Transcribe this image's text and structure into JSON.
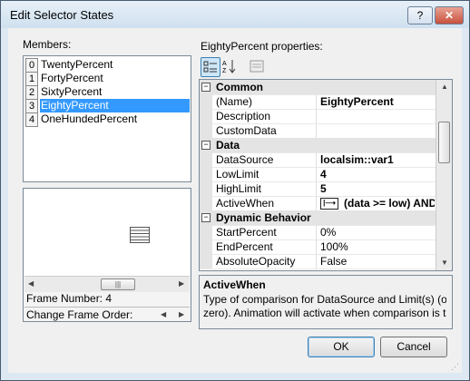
{
  "window": {
    "title": "Edit Selector States",
    "help_label": "?",
    "close_label": "✕"
  },
  "members": {
    "label": "Members:",
    "items": [
      {
        "index": "0",
        "name": "TwentyPercent"
      },
      {
        "index": "1",
        "name": "FortyPercent"
      },
      {
        "index": "2",
        "name": "SixtyPercent"
      },
      {
        "index": "3",
        "name": "EightyPercent"
      },
      {
        "index": "4",
        "name": "OneHundedPercent"
      }
    ],
    "selected_index": 3
  },
  "preview": {
    "frame_number": "Frame Number: 4",
    "change_order_label": "Change Frame Order:",
    "scroll_thumb": "|||"
  },
  "properties": {
    "label": "EightyPercent properties:",
    "categories": [
      {
        "name": "Common",
        "expander": "−",
        "rows": [
          {
            "name": "(Name)",
            "value": "EightyPercent",
            "bold": true
          },
          {
            "name": "Description",
            "value": ""
          },
          {
            "name": "CustomData",
            "value": ""
          }
        ]
      },
      {
        "name": "Data",
        "expander": "−",
        "rows": [
          {
            "name": "DataSource",
            "value": "localsim::var1",
            "bold": true
          },
          {
            "name": "LowLimit",
            "value": "4",
            "bold": true
          },
          {
            "name": "HighLimit",
            "value": "5",
            "bold": true
          },
          {
            "name": "ActiveWhen",
            "value": "(data >= low) AND",
            "bold": true,
            "icon": true
          }
        ]
      },
      {
        "name": "Dynamic Behavior",
        "expander": "−",
        "rows": [
          {
            "name": "StartPercent",
            "value": "0%"
          },
          {
            "name": "EndPercent",
            "value": "100%"
          },
          {
            "name": "AbsoluteOpacity",
            "value": "False"
          }
        ]
      }
    ]
  },
  "description": {
    "title": "ActiveWhen",
    "lines": [
      "Type of comparison for DataSource and Limit(s) (or",
      "zero).  Animation will activate when comparison is tr..."
    ]
  },
  "buttons": {
    "ok": "OK",
    "cancel": "Cancel"
  }
}
